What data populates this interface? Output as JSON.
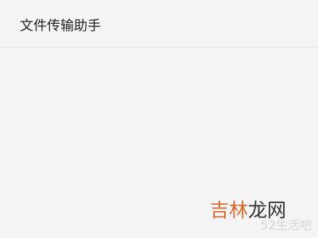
{
  "window": {
    "title": "文件传输助手"
  },
  "watermark": {
    "main_orange": "吉林",
    "main_dark": "龙网",
    "sub": "52生活吧",
    "colors": {
      "orange": "#d9692c",
      "dark": "#333333",
      "sub": "#d6d6d6"
    }
  },
  "colors": {
    "background": "#f4f4f4",
    "divider": "#e4e4e4",
    "title_text": "#222222"
  }
}
